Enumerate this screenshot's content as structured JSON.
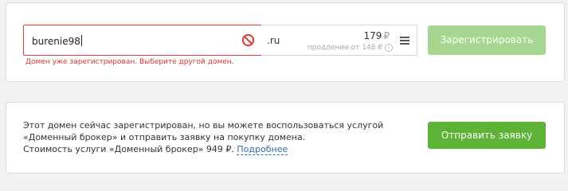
{
  "domain_form": {
    "input_value": "burenie98",
    "zone": ".ru",
    "price": "179",
    "currency": "₽",
    "renewal_text": "продление от 148 ₽",
    "error_message": "Домен уже зарегистрирован. Выберите другой домен.",
    "register_label": "Зарегистрировать"
  },
  "broker_notice": {
    "line1": "Этот домен сейчас зарегистрирован, но вы можете воспользоваться услугой",
    "line2": "«Доменный брокер» и отправить заявку на покупку домена.",
    "line3_prefix": "Стоимость услуги «Доменный брокер» 949 ₽.",
    "more_link": "Подробнее",
    "request_label": "Отправить заявку"
  },
  "colors": {
    "error": "#e23a3a",
    "accent_green": "#5cb336",
    "disabled_green": "#a6d68f",
    "link": "#2b6cb0"
  },
  "icons": {
    "blocked": "no-entry-icon",
    "menu": "hamburger-menu-icon",
    "info": "info-icon"
  }
}
